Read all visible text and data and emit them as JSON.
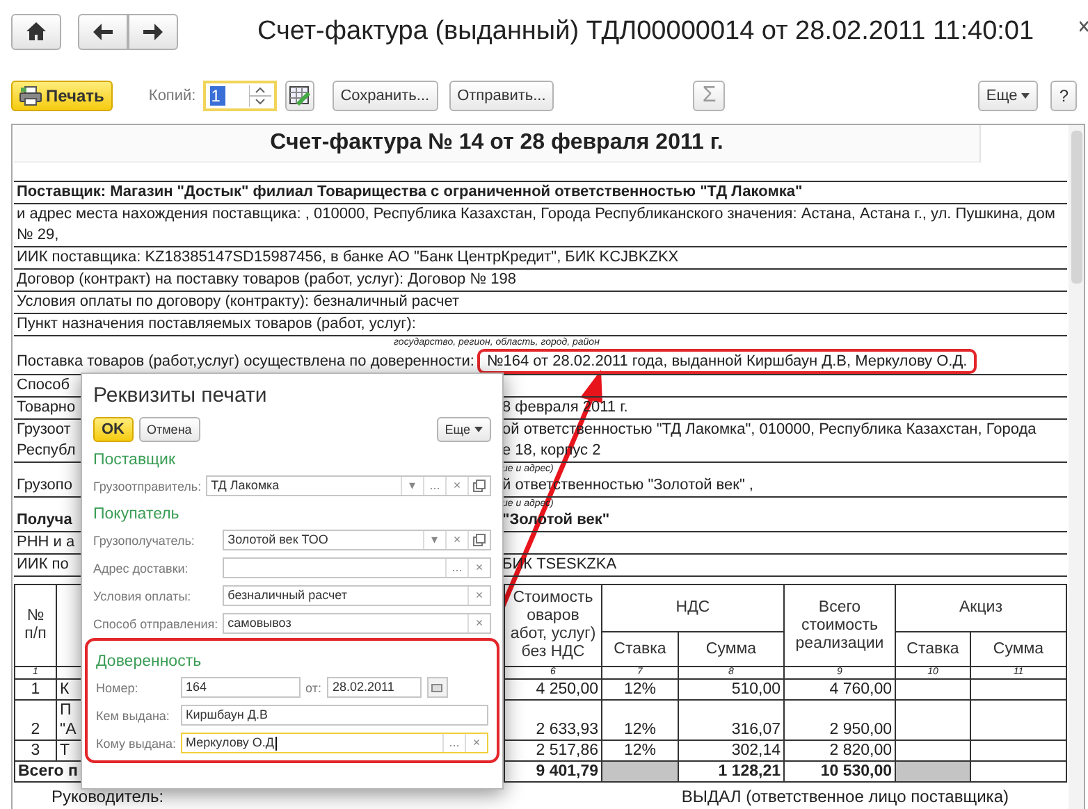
{
  "window": {
    "title": "Счет-фактура (выданный) ТДЛ00000014 от 28.02.2011 11:40:01"
  },
  "toolbar": {
    "print": "Печать",
    "copies_label": "Копий:",
    "copies": "1",
    "copies_focused": true,
    "save": "Сохранить...",
    "send": "Отправить...",
    "sum": "Σ",
    "more": "Еще",
    "help": "?"
  },
  "document": {
    "title": "Счет-фактура № 14 от 28 февраля 2011 г.",
    "rows": [
      {
        "kind": "full",
        "bold": true,
        "text": "Поставщик: Магазин \"Достык\" филиал Товарищества с ограниченной ответственностью \"ТД Лакомка\""
      },
      {
        "kind": "full",
        "bold": false,
        "text": "и адрес места нахождения поставщика: , 010000, Республика Казахстан, Города Республиканского значения: Астана, Астана г., ул. Пушкина, дом № 29,"
      },
      {
        "kind": "full",
        "bold": false,
        "text": "ИИК поставщика: KZ18385147SD15987456, в банке АО \"Банк ЦентрКредит\", БИК KCJBKZKX"
      },
      {
        "kind": "full",
        "bold": false,
        "text": "Договор (контракт) на поставку товаров (работ, услуг): Договор № 198"
      },
      {
        "kind": "full",
        "bold": false,
        "text": "Условия оплаты по договору (контракту): безналичный расчет"
      },
      {
        "kind": "full",
        "bold": false,
        "text": "Пункт назначения поставляемых товаров (работ, услуг):"
      },
      {
        "kind": "caption",
        "text": "государство, регион, область, город, район"
      },
      {
        "kind": "highlight",
        "bold": false,
        "text": "Поставка товаров (работ,услуг) осуществлена по доверенности:",
        "highlight": "№164 от 28.02.2011 года, выданной Киршбаун Д.В, Меркулову О.Д."
      },
      {
        "kind": "split",
        "bold": false,
        "left": [
          "Способ"
        ]
      },
      {
        "kind": "split",
        "bold": false,
        "left": [
          "Товарно"
        ],
        "right": [
          "8 февраля 2011 г."
        ]
      },
      {
        "kind": "split",
        "bold": false,
        "left": [
          "Грузоот",
          "Республ"
        ],
        "right": [
          "ой ответственностью \"ТД Лакомка\", 010000, Республика Казахстан, Города",
          "е 18, корпус 2"
        ]
      },
      {
        "kind": "note",
        "text": "ие и адрес)"
      },
      {
        "kind": "split",
        "bold": false,
        "left": [
          "Грузопо"
        ],
        "right": [
          "й ответственностью \"Золотой век\" ,"
        ]
      },
      {
        "kind": "note",
        "text": "ие и адрес)"
      },
      {
        "kind": "split",
        "bold": true,
        "left": [
          "Получа"
        ],
        "right": [
          "\"Золотой век\""
        ]
      },
      {
        "kind": "split",
        "bold": false,
        "left": [
          "РНН и а"
        ]
      },
      {
        "kind": "split",
        "bold": false,
        "left": [
          "ИИК по"
        ],
        "right": [
          "БИК TSESKZKA"
        ]
      }
    ]
  },
  "table": {
    "header": {
      "number": "№ п/п",
      "cost": [
        "Стоимость",
        "оваров",
        "абот, услуг)",
        "без НДС"
      ],
      "vat": "НДС",
      "vat_rate": "Ставка",
      "vat_sum": "Сумма",
      "total": "Всего стоимость реализации",
      "excise": "Акциз",
      "excise_rate": "Ставка",
      "excise_sum": "Сумма"
    },
    "column_numbers": [
      "1",
      "6",
      "7",
      "8",
      "9",
      "10",
      "11"
    ],
    "rows": [
      {
        "number": "1",
        "name": [
          "К"
        ],
        "cost": "4 250,00",
        "rate": "12%",
        "vat": "510,00",
        "total": "4 760,00"
      },
      {
        "number": "2",
        "name": [
          "П",
          "\"А"
        ],
        "cost": "2 633,93",
        "rate": "12%",
        "vat": "316,07",
        "total": "2 950,00"
      },
      {
        "number": "3",
        "name": [
          "Т"
        ],
        "cost": "2 517,86",
        "rate": "12%",
        "vat": "302,14",
        "total": "2 820,00"
      }
    ],
    "total": {
      "label": "Всего п",
      "cost": "9 401,79",
      "vat": "1 128,21",
      "total": "10 530,00"
    }
  },
  "signatures": {
    "left": "Руководитель:",
    "right": "ВЫДАЛ (ответственное лицо поставщика)"
  },
  "dialog": {
    "title": "Реквизиты печати",
    "ok": "OK",
    "cancel": "Отмена",
    "more": "Еще",
    "sections": [
      {
        "title": "Поставщик",
        "highlighted": false,
        "fields": [
          {
            "kind": "field",
            "label": "Грузоотправитель:",
            "value": "ТД Лакомка",
            "focused": false,
            "buttons": [
              "▾",
              "...",
              "×"
            ],
            "open_button": true
          }
        ]
      },
      {
        "title": "Покупатель",
        "highlighted": false,
        "fields": [
          {
            "kind": "field",
            "label": "Грузополучатель:",
            "value": "Золотой век ТОО",
            "focused": false,
            "buttons": [
              "▾",
              "×"
            ],
            "open_button": true
          },
          {
            "kind": "field",
            "label": "Адрес доставки:",
            "focused": false,
            "buttons": [
              "...",
              "×"
            ]
          },
          {
            "kind": "field",
            "label": "Условия оплаты:",
            "value": "безналичный расчет",
            "focused": false,
            "buttons": [
              "×"
            ]
          },
          {
            "kind": "field",
            "label": "Способ отправления:",
            "value": "самовывоз",
            "focused": false,
            "buttons": [
              "×"
            ]
          }
        ]
      },
      {
        "title": "Доверенность",
        "highlighted": true,
        "fields": [
          {
            "kind": "number_date",
            "label": "Номер:",
            "value": "164",
            "date_label": "от:",
            "date": "28.02.2011",
            "focused": false
          },
          {
            "kind": "field",
            "label": "Кем выдана:",
            "value": "Киршбаун Д.В",
            "focused": false
          },
          {
            "kind": "field",
            "label": "Кому выдана:",
            "value": "Меркулову О.Д",
            "focused": true,
            "buttons": [
              "...",
              "×"
            ]
          }
        ]
      }
    ]
  }
}
